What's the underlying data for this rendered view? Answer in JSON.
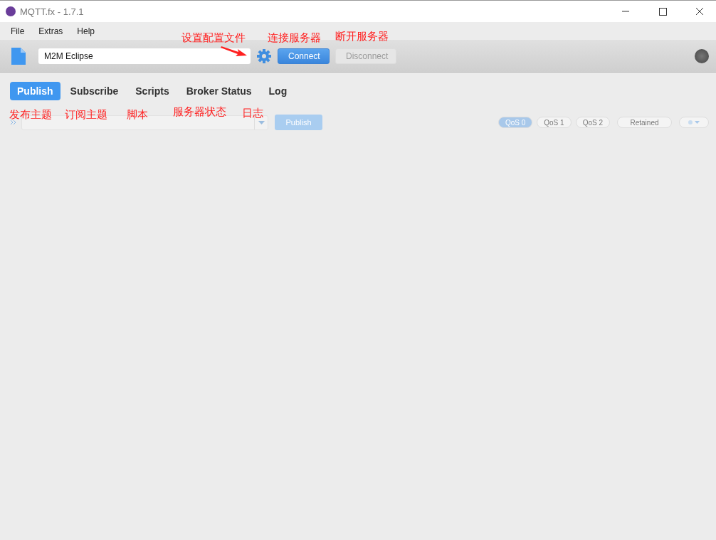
{
  "window": {
    "title": "MQTT.fx - 1.7.1"
  },
  "menu": [
    "File",
    "Extras",
    "Help"
  ],
  "toolbar": {
    "profile": "M2M Eclipse",
    "connect": {
      "label": "Connect",
      "disabled": false
    },
    "disconnect": {
      "label": "Disconnect",
      "disabled": true
    },
    "connected": false
  },
  "tabs": [
    {
      "label": "Publish",
      "selected": true
    },
    {
      "label": "Subscribe",
      "selected": false
    },
    {
      "label": "Scripts",
      "selected": false
    },
    {
      "label": "Broker Status",
      "selected": false
    },
    {
      "label": "Log",
      "selected": false
    }
  ],
  "publish_bar": {
    "publish": {
      "label": "Publish",
      "disabled": true
    },
    "qos": [
      {
        "label": "QoS 0",
        "selected": true
      },
      {
        "label": "QoS 1",
        "selected": false
      },
      {
        "label": "QoS 2",
        "selected": false
      }
    ],
    "retained": {
      "label": "Retained",
      "selected": false
    }
  },
  "annotations": [
    {
      "text": "设置配置文件"
    },
    {
      "text": "连接服务器"
    },
    {
      "text": "断开服务器"
    },
    {
      "text": "发布主题"
    },
    {
      "text": "订阅主题"
    },
    {
      "text": "脚本"
    },
    {
      "text": "服务器状态"
    },
    {
      "text": "日志"
    }
  ]
}
